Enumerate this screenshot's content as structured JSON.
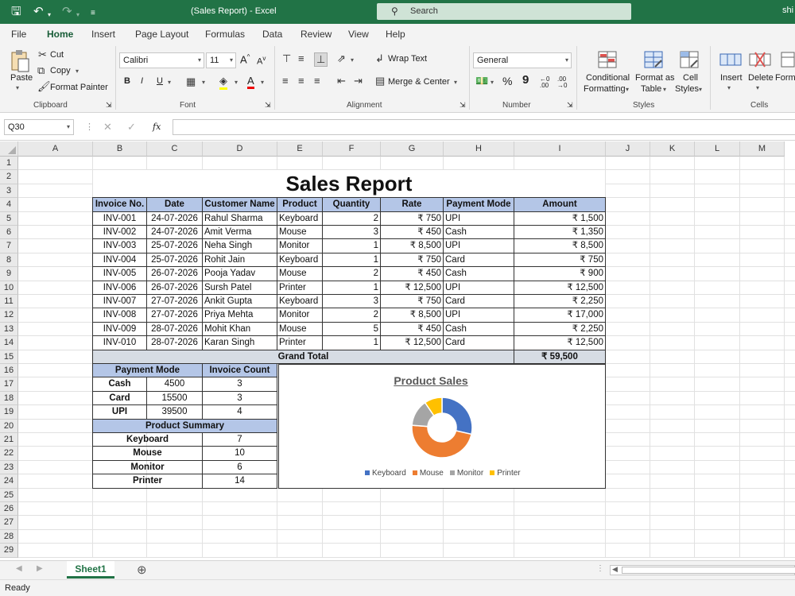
{
  "titlebar": {
    "doc_title": "(Sales Report)  -  Excel",
    "search_placeholder": "Search",
    "user": "shi"
  },
  "tabs": [
    "File",
    "Home",
    "Insert",
    "Page Layout",
    "Formulas",
    "Data",
    "Review",
    "View",
    "Help"
  ],
  "ribbon": {
    "clipboard": {
      "paste": "Paste",
      "cut": "Cut",
      "copy": "Copy",
      "format_painter": "Format Painter",
      "label": "Clipboard"
    },
    "font": {
      "name": "Calibri",
      "size": "11",
      "label": "Font",
      "bold": "B",
      "italic": "I",
      "underline": "U",
      "grow": "A",
      "shrink": "A",
      "color_a": "A"
    },
    "alignment": {
      "wrap": "Wrap Text",
      "merge": "Merge & Center",
      "label": "Alignment"
    },
    "number": {
      "format": "General",
      "percent": "%",
      "comma": "9",
      "label": "Number",
      "inc": "←0 .00",
      "dec": ".00 →0"
    },
    "styles": {
      "conditional_1": "Conditional",
      "conditional_2": "Formatting",
      "format_table_1": "Format as",
      "format_table_2": "Table",
      "cell_styles_1": "Cell",
      "cell_styles_2": "Styles",
      "label": "Styles"
    },
    "cells": {
      "insert": "Insert",
      "delete": "Delete",
      "format": "Form",
      "label": "Cells"
    }
  },
  "formula_bar": {
    "name_box": "Q30",
    "fx": "fx",
    "value": ""
  },
  "columns": [
    "A",
    "B",
    "C",
    "D",
    "E",
    "F",
    "G",
    "H",
    "I",
    "J",
    "K",
    "L",
    "M"
  ],
  "rows": [
    "1",
    "2",
    "3",
    "4",
    "5",
    "6",
    "7",
    "8",
    "9",
    "10",
    "11",
    "12",
    "13",
    "14",
    "15",
    "16",
    "17",
    "18",
    "19",
    "20",
    "21",
    "22",
    "23",
    "24",
    "25",
    "26",
    "27",
    "28",
    "29"
  ],
  "report": {
    "title": "Sales Report",
    "headers": [
      "Invoice No.",
      "Date",
      "Customer Name",
      "Product",
      "Quantity",
      "Rate",
      "Payment Mode",
      "Amount"
    ],
    "rows": [
      [
        "INV-001",
        "24-07-2026",
        "Rahul Sharma",
        "Keyboard",
        "2",
        "₹ 750",
        "UPI",
        "₹ 1,500"
      ],
      [
        "INV-002",
        "24-07-2026",
        "Amit Verma",
        "Mouse",
        "3",
        "₹ 450",
        "Cash",
        "₹ 1,350"
      ],
      [
        "INV-003",
        "25-07-2026",
        "Neha Singh",
        "Monitor",
        "1",
        "₹ 8,500",
        "UPI",
        "₹ 8,500"
      ],
      [
        "INV-004",
        "25-07-2026",
        "Rohit Jain",
        "Keyboard",
        "1",
        "₹ 750",
        "Card",
        "₹ 750"
      ],
      [
        "INV-005",
        "26-07-2026",
        "Pooja Yadav",
        "Mouse",
        "2",
        "₹ 450",
        "Cash",
        "₹ 900"
      ],
      [
        "INV-006",
        "26-07-2026",
        "Sursh Patel",
        "Printer",
        "1",
        "₹ 12,500",
        "UPI",
        "₹ 12,500"
      ],
      [
        "INV-007",
        "27-07-2026",
        "Ankit Gupta",
        "Keyboard",
        "3",
        "₹ 750",
        "Card",
        "₹ 2,250"
      ],
      [
        "INV-008",
        "27-07-2026",
        "Priya Mehta",
        "Monitor",
        "2",
        "₹ 8,500",
        "UPI",
        "₹ 17,000"
      ],
      [
        "INV-009",
        "28-07-2026",
        "Mohit Khan",
        "Mouse",
        "5",
        "₹ 450",
        "Cash",
        "₹ 2,250"
      ],
      [
        "INV-010",
        "28-07-2026",
        "Karan Singh",
        "Printer",
        "1",
        "₹ 12,500",
        "Card",
        "₹ 12,500"
      ]
    ],
    "grand_total_label": "Grand Total",
    "grand_total_value": "₹ 59,500"
  },
  "payment_summary": {
    "headers": [
      "Payment Mode",
      "Invoice Count"
    ],
    "rows": [
      [
        "Cash",
        "4500",
        "3"
      ],
      [
        "Card",
        "15500",
        "3"
      ],
      [
        "UPI",
        "39500",
        "4"
      ]
    ]
  },
  "product_summary": {
    "title": "Product Summary",
    "rows": [
      [
        "Keyboard",
        "7"
      ],
      [
        "Mouse",
        "10"
      ],
      [
        "Monitor",
        "6"
      ],
      [
        "Printer",
        "14"
      ]
    ]
  },
  "chart_data": {
    "type": "pie",
    "title": "Product Sales",
    "categories": [
      "Keyboard",
      "Mouse",
      "Monitor",
      "Printer"
    ],
    "values": [
      6,
      10,
      3,
      2
    ],
    "colors": [
      "#4472c4",
      "#ed7d31",
      "#a5a5a5",
      "#ffc000"
    ],
    "legend": "bottom",
    "donut": true
  },
  "sheets": {
    "active": "Sheet1"
  },
  "status": {
    "text": "Ready"
  }
}
